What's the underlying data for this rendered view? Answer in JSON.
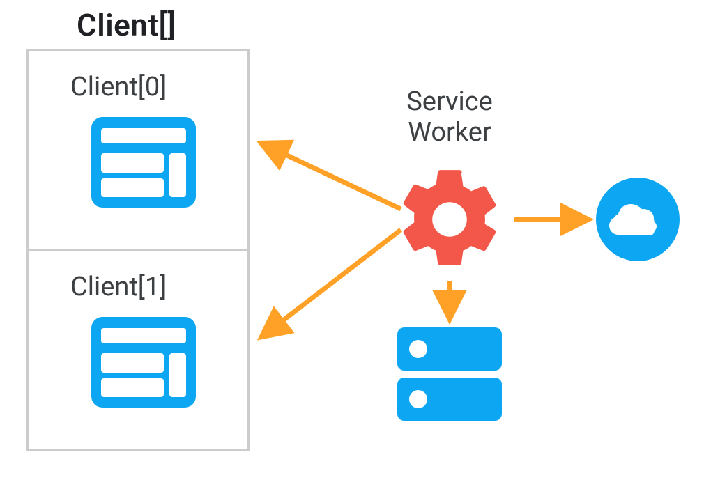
{
  "title": "Client[]",
  "clients": [
    {
      "label": "Client[0]"
    },
    {
      "label": "Client[1]"
    }
  ],
  "serviceWorker": {
    "label_line1": "Service",
    "label_line2": "Worker"
  },
  "colors": {
    "blue": "#0da6f2",
    "red": "#f25749",
    "orange": "#ffa126",
    "border": "#cccccc",
    "text": "#3c4043"
  },
  "icons": {
    "client0": "browser-icon",
    "client1": "browser-icon",
    "serviceWorker": "gear-icon",
    "storage": "server-icon",
    "network": "cloud-icon"
  },
  "arrows": [
    {
      "from": "service-worker",
      "to": "client0",
      "bidirectional": false
    },
    {
      "from": "service-worker",
      "to": "client1",
      "bidirectional": false
    },
    {
      "from": "service-worker",
      "to": "storage",
      "bidirectional": false
    },
    {
      "from": "service-worker",
      "to": "network",
      "bidirectional": false
    }
  ]
}
